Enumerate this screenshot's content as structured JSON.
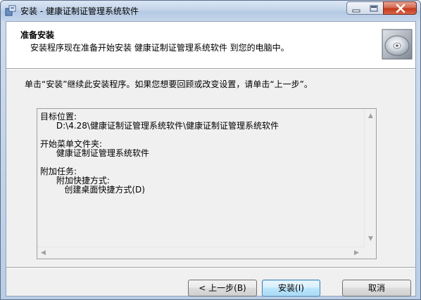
{
  "window": {
    "title": "安装 - 健康证制证管理系统软件"
  },
  "header": {
    "title": "准备安装",
    "subtitle": "安装程序现在准备开始安装 健康证制证管理系统软件 到您的电脑中。",
    "icon": "cd-disc-icon"
  },
  "instruction": "单击“安装”继续此安装程序。如果您想要回顾或改变设置，请单击“上一步”。",
  "summary": {
    "lines": [
      "目标位置:",
      "      D:\\4.28\\健康证制证管理系统软件\\健康证制证管理系统软件",
      "",
      "开始菜单文件夹:",
      "      健康证制证管理系统软件",
      "",
      "附加任务:",
      "      附加快捷方式:",
      "         创建桌面快捷方式(D)"
    ]
  },
  "buttons": {
    "back": "< 上一步(B)",
    "install": "安装(I)",
    "cancel": "取消"
  }
}
